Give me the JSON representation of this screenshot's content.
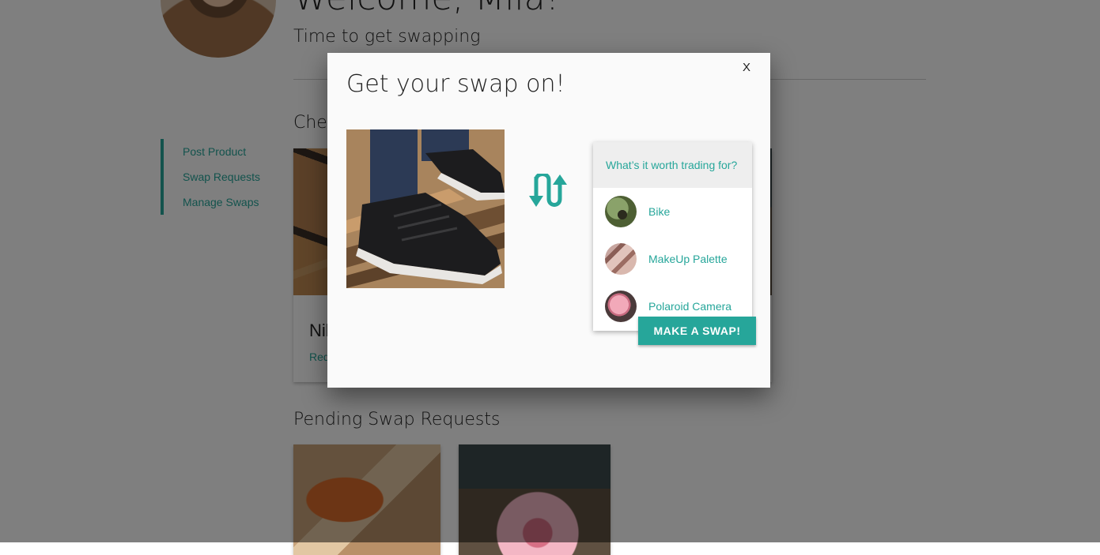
{
  "page": {
    "welcome_text": "Welcome, Miia!",
    "tagline": "Time to get swapping"
  },
  "side_nav": {
    "items": [
      {
        "label": "Post Product"
      },
      {
        "label": "Swap Requests"
      },
      {
        "label": "Manage Swaps"
      }
    ]
  },
  "sections": {
    "check_title": "Check",
    "card_name": "Nik",
    "card_request": "Requ",
    "pending_title": "Pending Swap Requests"
  },
  "modal": {
    "title": "Get your swap on!",
    "close_label": "X",
    "dropdown_header": "What’s it worth trading for?",
    "options": [
      {
        "label": "Bike"
      },
      {
        "label": "MakeUp Palette"
      },
      {
        "label": "Polaroid Camera"
      }
    ],
    "make_swap_label": "MAKE A SWAP!"
  },
  "colors": {
    "accent": "#26a69a",
    "overlay": "rgba(0,0,0,0.5)"
  },
  "icons": {
    "swap": "swap-arrows-icon",
    "close": "close-icon"
  }
}
